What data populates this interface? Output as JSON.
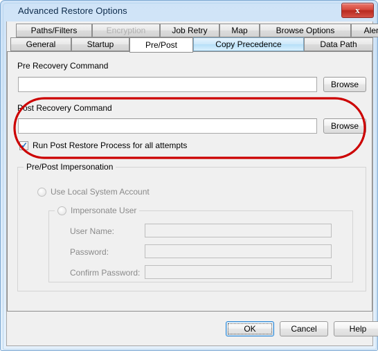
{
  "window": {
    "title": "Advanced Restore Options",
    "close_glyph": "x"
  },
  "tabs": {
    "row1": [
      {
        "label": "Paths/Filters",
        "state": "normal"
      },
      {
        "label": "Encryption",
        "state": "disabled"
      },
      {
        "label": "Job Retry",
        "state": "normal"
      },
      {
        "label": "Map",
        "state": "normal"
      },
      {
        "label": "Browse Options",
        "state": "normal"
      },
      {
        "label": "Alert",
        "state": "normal"
      }
    ],
    "row2": [
      {
        "label": "General",
        "state": "normal"
      },
      {
        "label": "Startup",
        "state": "normal"
      },
      {
        "label": "Pre/Post",
        "state": "selected"
      },
      {
        "label": "Copy Precedence",
        "state": "hot"
      },
      {
        "label": "Data Path",
        "state": "normal"
      }
    ]
  },
  "pre_recovery": {
    "label": "Pre Recovery Command",
    "value": "",
    "placeholder": "",
    "browse_label": "Browse"
  },
  "post_recovery": {
    "label": "Post Recovery Command",
    "value": "",
    "placeholder": "",
    "browse_label": "Browse",
    "checkbox_label": "Run Post Restore Process for all attempts",
    "checkbox_checked": true,
    "check_glyph": "✓"
  },
  "impersonation": {
    "group_label": "Pre/Post Impersonation",
    "use_local_system_label": "Use Local System Account",
    "use_local_system_selected": false,
    "impersonate_user_label": "Impersonate User",
    "impersonate_user_selected": false,
    "fields": [
      {
        "label": "User Name:",
        "value": ""
      },
      {
        "label": "Password:",
        "value": ""
      },
      {
        "label": "Confirm Password:",
        "value": ""
      }
    ]
  },
  "buttons": {
    "ok": "OK",
    "cancel": "Cancel",
    "help": "Help"
  },
  "colors": {
    "annotation": "#cc0000",
    "titlebar_start": "#cfe3f7",
    "accent_tab_hot": "#b6dff8",
    "check_blue": "#1b6ec2",
    "close_red": "#d6483c"
  }
}
